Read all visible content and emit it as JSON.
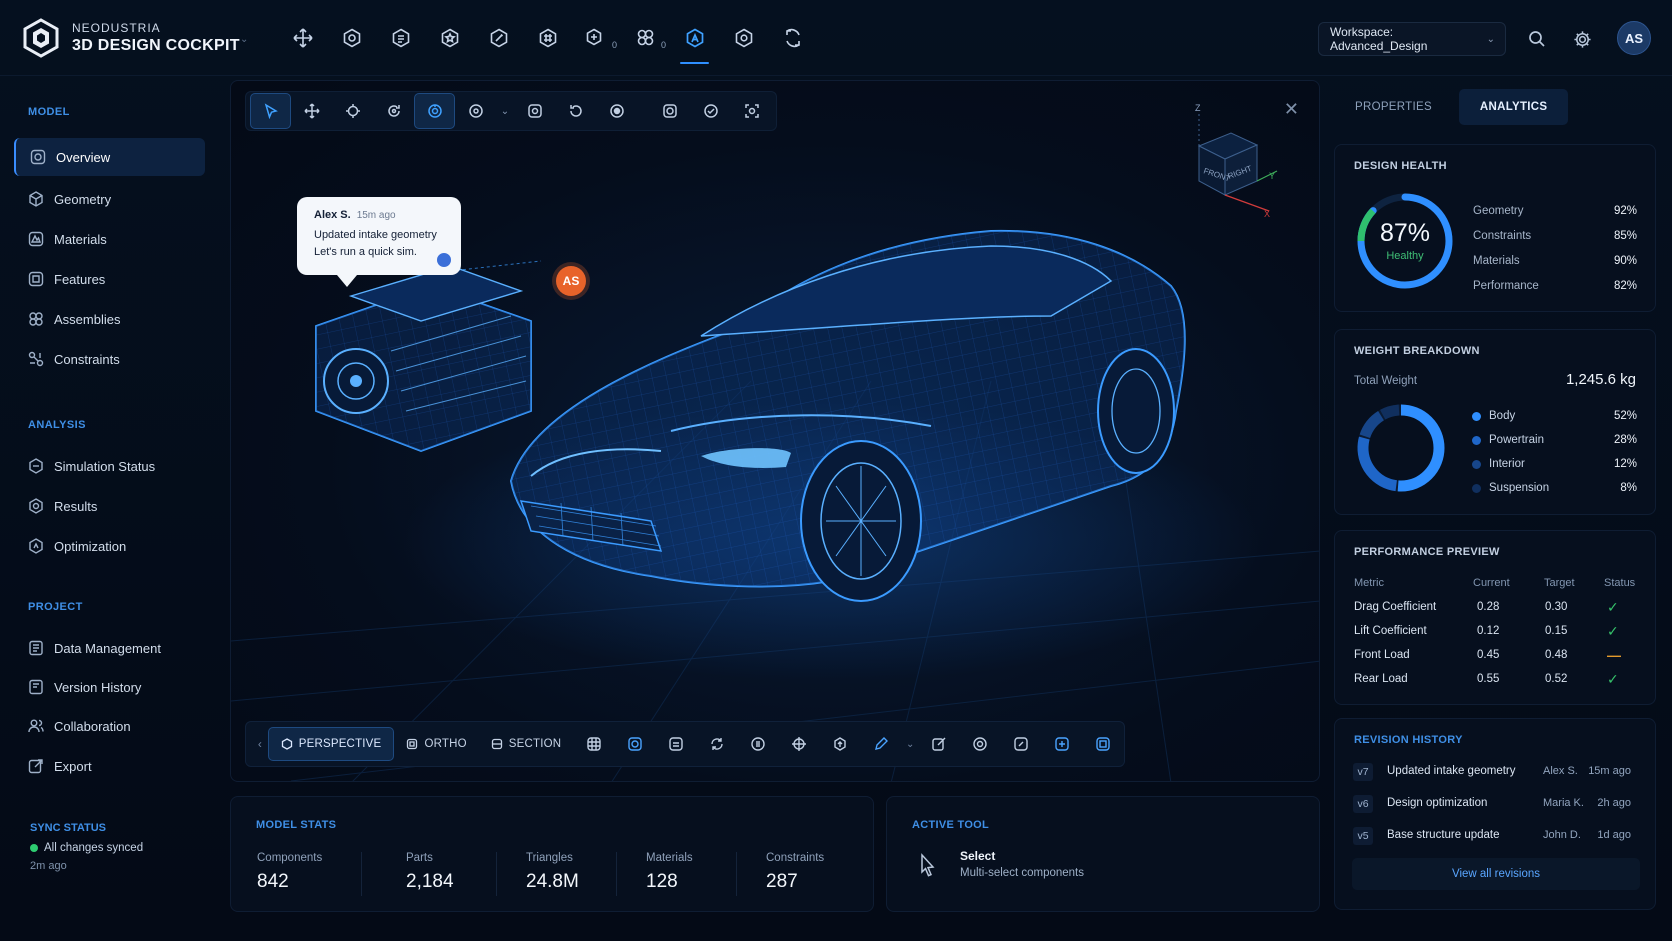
{
  "brand": {
    "line1": "NEODUSTRIA",
    "line2": "3D DESIGN COCKPIT"
  },
  "toolbar": {
    "icons": [
      "move-icon",
      "component-icon",
      "part-icon",
      "feature-icon",
      "sketch-icon",
      "mesh-icon",
      "simulation-icon",
      "analysis-icon",
      "cockpit-icon",
      "settings-gear-icon",
      "sync-icon"
    ],
    "sub_badges": {
      "simulation": "0",
      "analysis": "0"
    },
    "active_index": 8
  },
  "workspace": {
    "label": "Workspace: Advanced_Design"
  },
  "user": {
    "initials": "AS"
  },
  "sidebar": {
    "sections": [
      {
        "title": "MODEL",
        "items": [
          "Overview",
          "Geometry",
          "Materials",
          "Features",
          "Assemblies",
          "Constraints"
        ]
      },
      {
        "title": "ANALYSIS",
        "items": [
          "Simulation Status",
          "Results",
          "Optimization"
        ]
      },
      {
        "title": "PROJECT",
        "items": [
          "Data Management",
          "Version History",
          "Collaboration",
          "Export"
        ]
      }
    ],
    "active_item": "Overview",
    "sync": {
      "title": "SYNC STATUS",
      "text": "All changes synced",
      "time": "2m ago"
    }
  },
  "viewport": {
    "comment": {
      "author": "Alex S.",
      "time": "15m ago",
      "message": "Updated intake geometry Let's run a quick sim."
    },
    "pin_initials": "AS",
    "gizmo": {
      "z": "Z",
      "y": "Y",
      "x": "X",
      "front": "FRONT",
      "right": "RIGHT"
    },
    "view_modes": [
      "PERSPECTIVE",
      "ORTHO",
      "SECTION"
    ],
    "active_view": "PERSPECTIVE"
  },
  "model_stats": {
    "title": "MODEL STATS",
    "items": [
      {
        "label": "Components",
        "value": "842"
      },
      {
        "label": "Parts",
        "value": "2,184"
      },
      {
        "label": "Triangles",
        "value": "24.8M"
      },
      {
        "label": "Materials",
        "value": "128"
      },
      {
        "label": "Constraints",
        "value": "287"
      }
    ]
  },
  "active_tool": {
    "title": "ACTIVE TOOL",
    "name": "Select",
    "desc": "Multi-select components"
  },
  "right_tabs": [
    "PROPERTIES",
    "ANALYTICS"
  ],
  "active_right_tab": "ANALYTICS",
  "design_health": {
    "title": "DESIGN HEALTH",
    "score": "87%",
    "score_value": 87,
    "status": "Healthy",
    "rows": [
      {
        "name": "Geometry",
        "pct": "92%"
      },
      {
        "name": "Constraints",
        "pct": "85%"
      },
      {
        "name": "Materials",
        "pct": "90%"
      },
      {
        "name": "Performance",
        "pct": "82%"
      }
    ]
  },
  "weight": {
    "title": "WEIGHT BREAKDOWN",
    "total_label": "Total Weight",
    "total": "1,245.6 kg",
    "items": [
      {
        "name": "Body",
        "pct": "52%",
        "value": 52,
        "color": "#2f8fff"
      },
      {
        "name": "Powertrain",
        "pct": "28%",
        "value": 28,
        "color": "#1f66c8"
      },
      {
        "name": "Interior",
        "pct": "12%",
        "value": 12,
        "color": "#17468a"
      },
      {
        "name": "Suspension",
        "pct": "8%",
        "value": 8,
        "color": "#102f5e"
      }
    ]
  },
  "performance": {
    "title": "PERFORMANCE PREVIEW",
    "headers": [
      "Metric",
      "Current",
      "Target",
      "Status"
    ],
    "rows": [
      {
        "metric": "Drag Coefficient",
        "current": "0.28",
        "target": "0.30",
        "status": "ok"
      },
      {
        "metric": "Lift Coefficient",
        "current": "0.12",
        "target": "0.15",
        "status": "ok"
      },
      {
        "metric": "Front Load",
        "current": "0.45",
        "target": "0.48",
        "status": "warn"
      },
      {
        "metric": "Rear Load",
        "current": "0.55",
        "target": "0.52",
        "status": "ok"
      }
    ],
    "status_colors": {
      "ok": "#36c26b",
      "warn": "#e39a2c"
    }
  },
  "revisions": {
    "title": "REVISION HISTORY",
    "items": [
      {
        "ver": "v7",
        "title": "Updated intake geometry",
        "author": "Alex S.",
        "when": "15m ago"
      },
      {
        "ver": "v6",
        "title": "Design optimization",
        "author": "Maria K.",
        "when": "2h ago"
      },
      {
        "ver": "v5",
        "title": "Base structure update",
        "author": "John D.",
        "when": "1d ago"
      }
    ],
    "view_all": "View all revisions"
  },
  "colors": {
    "accent": "#2f8fff",
    "background": "#040a16",
    "healthy": "#2fbf6e"
  }
}
